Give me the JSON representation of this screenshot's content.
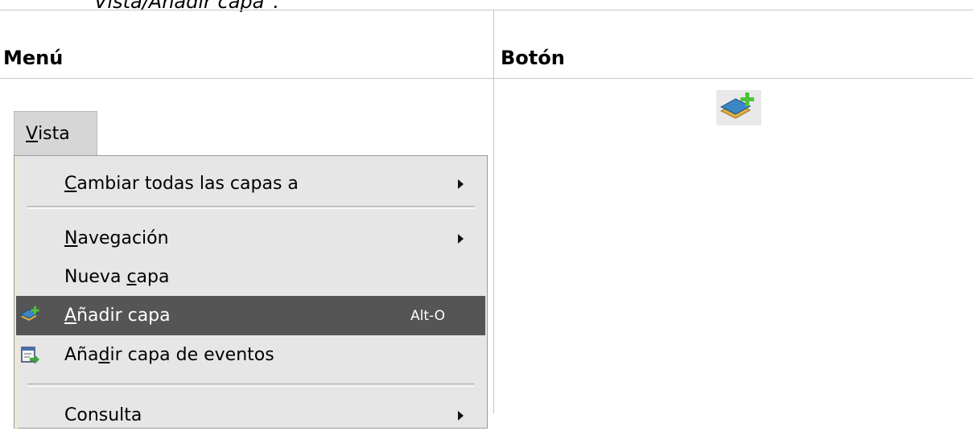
{
  "caption": "Vista/Añadir capa\".",
  "table": {
    "headers": [
      "Menú",
      "Botón"
    ]
  },
  "menu": {
    "title_mnemonic": "V",
    "title_rest": "ista",
    "items": [
      {
        "pre": "",
        "mnemonic": "C",
        "post": "ambiar todas las capas a",
        "submenu": true,
        "shortcut": ""
      },
      {
        "pre": "",
        "mnemonic": "N",
        "post": "avegación",
        "submenu": true,
        "shortcut": ""
      },
      {
        "pre": "Nueva ",
        "mnemonic": "c",
        "post": "apa",
        "submenu": false,
        "shortcut": ""
      },
      {
        "pre": "",
        "mnemonic": "A",
        "post": "ñadir capa",
        "submenu": false,
        "shortcut": "Alt-O",
        "icon": "add-layer-icon",
        "selected": true
      },
      {
        "pre": "Aña",
        "mnemonic": "d",
        "post": "ir capa de eventos",
        "submenu": false,
        "shortcut": "",
        "icon": "add-event-layer-icon"
      },
      {
        "pre": "Consulta",
        "mnemonic": "",
        "post": "",
        "submenu": true,
        "shortcut": ""
      }
    ]
  },
  "button": {
    "icon": "add-layer-icon"
  }
}
